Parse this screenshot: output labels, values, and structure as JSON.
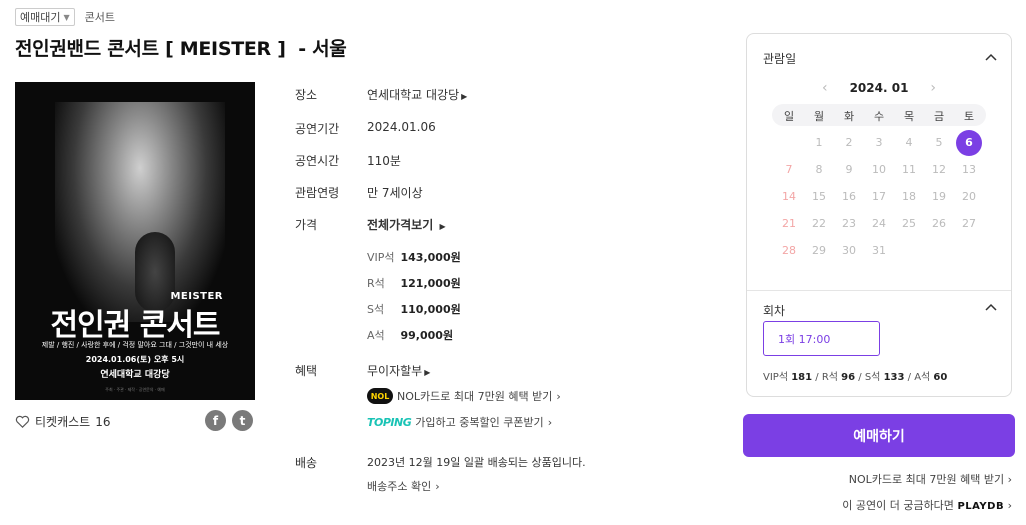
{
  "tags": {
    "status": "예매대기",
    "category": "콘서트"
  },
  "title": "전인권밴드 콘서트 [ MEISTER ]  - 서울",
  "poster": {
    "meister": "MEISTER",
    "title": "전인권 콘서트",
    "songs": "제발 / 행진 / 사랑한 후에 / 걱정 말아요 그대 / 그것만이 내 세상",
    "date": "2024.01.06(토) 오후 5시",
    "venue": "연세대학교 대강당",
    "footer": "주최 · 주관 · 제작 · 공연문의 · 예매"
  },
  "cast": {
    "label": "티켓캐스트",
    "count": "16"
  },
  "share": {
    "facebook_icon": "f",
    "twitter_icon": "t"
  },
  "info": {
    "venue": {
      "label": "장소",
      "value": "연세대학교 대강당"
    },
    "period": {
      "label": "공연기간",
      "value": "2024.01.06"
    },
    "runtime": {
      "label": "공연시간",
      "value": "110분"
    },
    "age": {
      "label": "관람연령",
      "value": "만 7세이상"
    },
    "price": {
      "label": "가격",
      "link": "전체가격보기",
      "items": [
        {
          "grade": "VIP석",
          "amount": "143,000원"
        },
        {
          "grade": "R석",
          "amount": "121,000원"
        },
        {
          "grade": "S석",
          "amount": "110,000원"
        },
        {
          "grade": "A석",
          "amount": "99,000원"
        }
      ]
    },
    "benefit": {
      "label": "혜택",
      "value": "무이자할부",
      "nol_logo": "NOL",
      "nol_text": "NOL카드로 최대 7만원 혜택 받기",
      "toping_logo": "TOPING",
      "toping_text": "가입하고 중복할인 쿠폰받기"
    },
    "delivery": {
      "label": "배송",
      "value": "2023년 12월 19일 일괄 배송되는 상품입니다.",
      "link": "배송주소 확인"
    }
  },
  "calendar": {
    "heading": "관람일",
    "month": "2024. 01",
    "weekdays": [
      "일",
      "월",
      "화",
      "수",
      "목",
      "금",
      "토"
    ],
    "selected_day": 6,
    "days": [
      [
        "",
        "1",
        "2",
        "3",
        "4",
        "5",
        "6"
      ],
      [
        "7",
        "8",
        "9",
        "10",
        "11",
        "12",
        "13"
      ],
      [
        "14",
        "15",
        "16",
        "17",
        "18",
        "19",
        "20"
      ],
      [
        "21",
        "22",
        "23",
        "24",
        "25",
        "26",
        "27"
      ],
      [
        "28",
        "29",
        "30",
        "31",
        "",
        "",
        ""
      ]
    ]
  },
  "round": {
    "heading": "회차",
    "option": "1회  17:00",
    "seats": [
      {
        "grade": "VIP석",
        "count": "181"
      },
      {
        "grade": "R석",
        "count": "96"
      },
      {
        "grade": "S석",
        "count": "133"
      },
      {
        "grade": "A석",
        "count": "60"
      }
    ]
  },
  "booking": {
    "button": "예매하기",
    "nol_link": "NOL카드로 최대 7만원 혜택 받기",
    "playdb_text": "이 공연이 더 궁금하다면",
    "playdb_logo": "PLAYDB"
  },
  "colors": {
    "accent": "#7b3fe4",
    "sunday": "#f3a6a6",
    "muted": "#bbbbbb"
  }
}
